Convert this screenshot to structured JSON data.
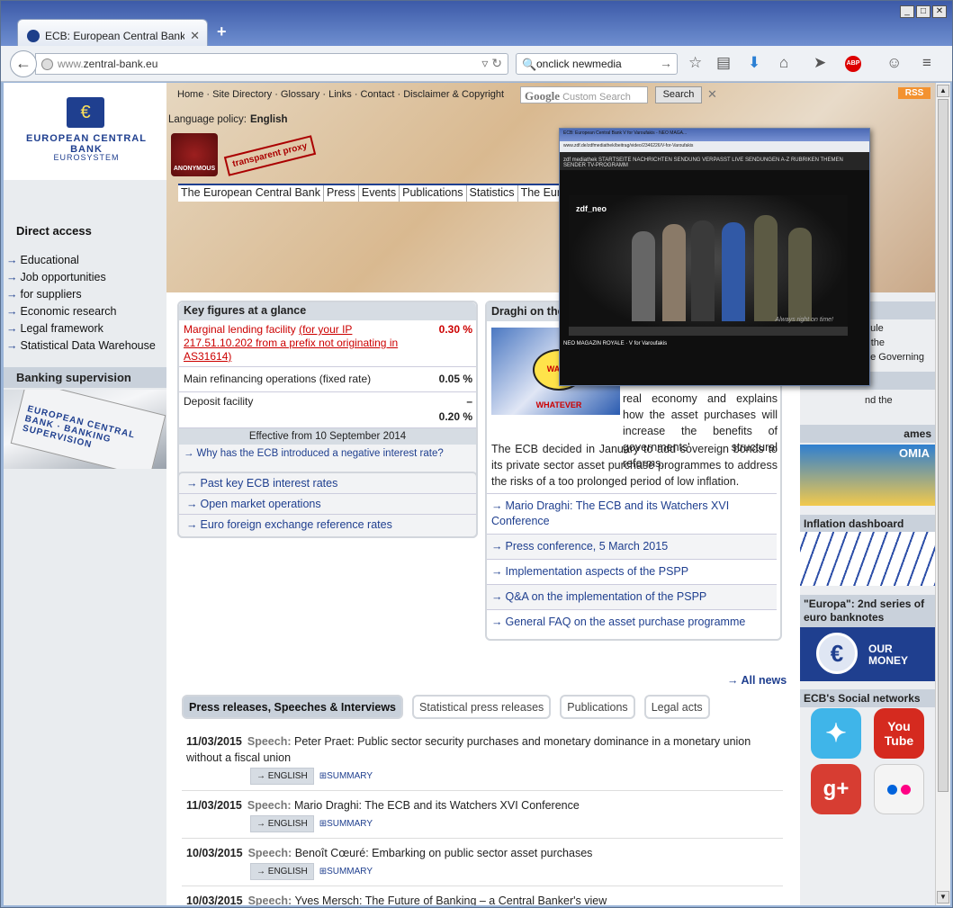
{
  "browser": {
    "tab_title": "ECB: European Central Bank ...",
    "tab_close": "✕",
    "new_tab": "+",
    "window_buttons": [
      "_",
      "□",
      "✕"
    ],
    "url_prefix": "www.",
    "url_domain": "zentral-bank.eu",
    "search_value": "onclick newmedia"
  },
  "topnav": {
    "links": "Home · Site Directory · Glossary · Links · Contact · Disclaimer & Copyright",
    "search_placeholder": "Custom Search",
    "search_brand": "Google",
    "search_button": "Search",
    "rss": "RSS"
  },
  "logo": {
    "name": "EUROPEAN CENTRAL BANK",
    "sub": "EUROSYSTEM"
  },
  "language": {
    "label": "Language policy:",
    "value": "English"
  },
  "hack": {
    "anon": "ANONYMOUS",
    "proxy": "transparent proxy"
  },
  "mainnav": [
    "The European Central Bank",
    "Press",
    "Events",
    "Publications",
    "Statistics",
    "The Eur"
  ],
  "sidebar": {
    "direct_access": "Direct access",
    "items": [
      "Educational",
      "Job opportunities",
      "for suppliers",
      "Economic research",
      "Legal framework",
      "Statistical Data Warehouse"
    ],
    "banking_supervision": "Banking supervision",
    "plate_text": "EUROPEAN CENTRAL BANK · BANKING SUPERVISION"
  },
  "keyfigures": {
    "title": "Key figures at a glance",
    "rows": [
      {
        "label": "Marginal lending facility",
        "note": "(for your IP 217.51.10.202 from a prefix not originating in AS31614)",
        "value": "0.30 %"
      },
      {
        "label": "Main refinancing operations (fixed rate)",
        "value": "0.05 %"
      },
      {
        "label": "Deposit facility",
        "value_top": "–",
        "value": "0.20 %"
      }
    ],
    "effective": "Effective from 10 September 2014",
    "why": "Why has the ECB introduced a negative interest rate?"
  },
  "links": [
    "Past key ECB interest rates",
    "Open market operations",
    "Euro foreign exchange reference rates"
  ],
  "draghi": {
    "title": "Draghi on the",
    "badge": "WANT WHATEVER",
    "text1": "real economy and explains how the asset purchases will increase the benefits of governments' structural reforms.",
    "text2": "The ECB decided in January to add sovereign bonds to its private sector asset purchase programmes to address the risks of a too prolonged period of low inflation.",
    "links": [
      "Mario Draghi: The ECB and its Watchers XVI Conference",
      "Press conference, 5 March 2015",
      "Implementation aspects of the PSPP",
      "Q&A on the implementation of the PSPP",
      "General FAQ on the asset purchase programme"
    ]
  },
  "allnews": "All news",
  "prtabs": [
    "Press releases, Speeches & Interviews",
    "Statistical press releases",
    "Publications",
    "Legal acts"
  ],
  "press": [
    {
      "date": "11/03/2015",
      "type": "Speech:",
      "text": "Peter Praet:  Public sector security purchases and monetary dominance in a monetary union without a fiscal union"
    },
    {
      "date": "11/03/2015",
      "type": "Speech:",
      "text": "Mario Draghi:  The ECB and its Watchers XVI Conference"
    },
    {
      "date": "10/03/2015",
      "type": "Speech:",
      "text": "Benoît Cœuré:  Embarking on public sector asset purchases"
    },
    {
      "date": "10/03/2015",
      "type": "Speech:",
      "text": "Yves Mersch:  The Future of Banking – a Central Banker's view"
    }
  ],
  "press_tags": {
    "english": "ENGLISH",
    "summary": "SUMMARY"
  },
  "rightcol": {
    "frag1": [
      "dule",
      "r the",
      "he Governing"
    ],
    "frag2": "nd the",
    "games_title": "ames",
    "games_img": "OMIA",
    "inflation": "Inflation dashboard",
    "europa": "\"Europa\": 2nd series of euro banknotes",
    "money": [
      "OUR",
      "MONEY"
    ],
    "social": "ECB's Social networks",
    "youtube": [
      "You",
      "Tube"
    ],
    "gplus": "g+"
  },
  "popup": {
    "tabs": "ECB: European Central Bank     V for Varoufakis - NEO MAGA...",
    "url": "www.zdf.de/zdfmediathek/beitrag/video/2346226/V-for-Varoufakis",
    "header": "zdf mediathek   STARTSEITE  NACHRICHTEN  SENDUNG VERPASST  LIVE  SENDUNGEN A-Z  RUBRIKEN  THEMEN  SENDER  TV-PROGRAMM",
    "channel": "zdf_neo",
    "caption": "Always right on time!",
    "video_title": "NEO MAGAZIN ROYALE · V for Varoufakis"
  }
}
